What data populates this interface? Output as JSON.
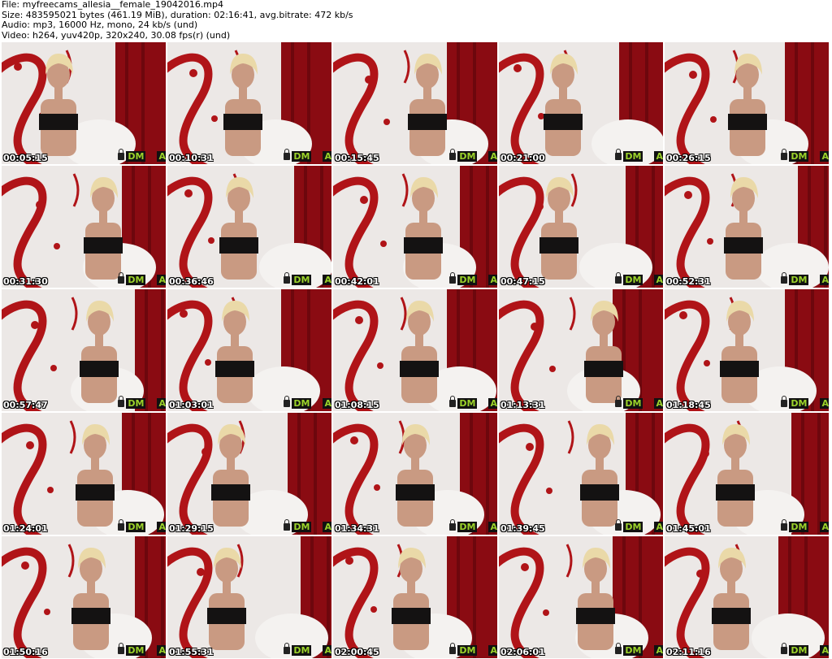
{
  "header": {
    "file_line": "File: myfreecams_allesia__female_19042016.mp4",
    "size_line": "Size: 483595021 bytes (461.19 MiB), duration: 02:16:41, avg.bitrate: 472 kb/s",
    "audio_line": "Audio: mp3, 16000 Hz, mono, 24 kb/s (und)",
    "video_line": "Video: h264, yuv420p, 320x240, 30.08 fps(r) (und)"
  },
  "watermark": {
    "dm": "DM",
    "a": "A",
    "icon": "lock-icon"
  },
  "colors": {
    "curtain": "#8a0b12",
    "wall": "#ece8e6",
    "swirl": "#b01418",
    "skin": "#c99a82",
    "hair": "#ead9a8",
    "top": "#141212",
    "chair": "#f4f2f0",
    "watermark_green": "#9bd22a"
  },
  "thumbnails": [
    {
      "time": "00:05:15"
    },
    {
      "time": "00:10:31"
    },
    {
      "time": "00:15:45"
    },
    {
      "time": "00:21:00"
    },
    {
      "time": "00:26:15"
    },
    {
      "time": "00:31:30"
    },
    {
      "time": "00:36:46"
    },
    {
      "time": "00:42:01"
    },
    {
      "time": "00:47:15"
    },
    {
      "time": "00:52:31"
    },
    {
      "time": "00:57:47"
    },
    {
      "time": "01:03:01"
    },
    {
      "time": "01:08:15"
    },
    {
      "time": "01:13:31"
    },
    {
      "time": "01:18:45"
    },
    {
      "time": "01:24:01"
    },
    {
      "time": "01:29:15"
    },
    {
      "time": "01:34:31"
    },
    {
      "time": "01:39:45"
    },
    {
      "time": "01:45:01"
    },
    {
      "time": "01:50:16"
    },
    {
      "time": "01:55:31"
    },
    {
      "time": "02:00:45"
    },
    {
      "time": "02:06:01"
    },
    {
      "time": "02:11:16"
    }
  ]
}
